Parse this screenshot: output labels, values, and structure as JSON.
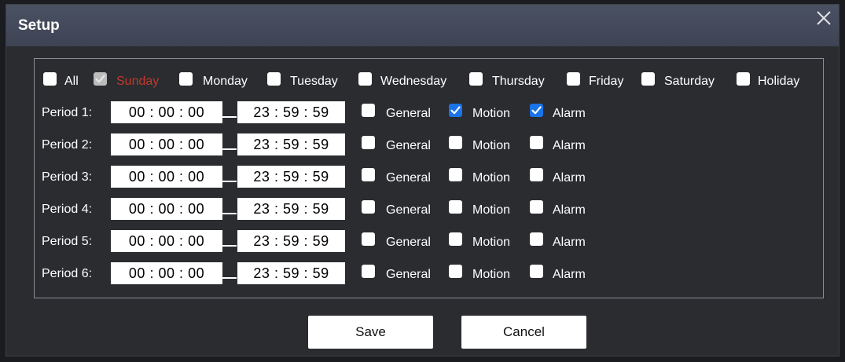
{
  "dialog": {
    "title": "Setup"
  },
  "days": [
    {
      "label": "All",
      "checked": false,
      "disabled": false
    },
    {
      "label": "Sunday",
      "checked": true,
      "disabled": true
    },
    {
      "label": "Monday",
      "checked": false,
      "disabled": false
    },
    {
      "label": "Tuesday",
      "checked": false,
      "disabled": false
    },
    {
      "label": "Wednesday",
      "checked": false,
      "disabled": false
    },
    {
      "label": "Thursday",
      "checked": false,
      "disabled": false
    },
    {
      "label": "Friday",
      "checked": false,
      "disabled": false
    },
    {
      "label": "Saturday",
      "checked": false,
      "disabled": false
    },
    {
      "label": "Holiday",
      "checked": false,
      "disabled": false
    }
  ],
  "periods": [
    {
      "label": "Period 1:",
      "start": [
        "00",
        "00",
        "00"
      ],
      "end": [
        "23",
        "59",
        "59"
      ],
      "general": false,
      "motion": true,
      "alarm": true
    },
    {
      "label": "Period 2:",
      "start": [
        "00",
        "00",
        "00"
      ],
      "end": [
        "23",
        "59",
        "59"
      ],
      "general": false,
      "motion": false,
      "alarm": false
    },
    {
      "label": "Period 3:",
      "start": [
        "00",
        "00",
        "00"
      ],
      "end": [
        "23",
        "59",
        "59"
      ],
      "general": false,
      "motion": false,
      "alarm": false
    },
    {
      "label": "Period 4:",
      "start": [
        "00",
        "00",
        "00"
      ],
      "end": [
        "23",
        "59",
        "59"
      ],
      "general": false,
      "motion": false,
      "alarm": false
    },
    {
      "label": "Period 5:",
      "start": [
        "00",
        "00",
        "00"
      ],
      "end": [
        "23",
        "59",
        "59"
      ],
      "general": false,
      "motion": false,
      "alarm": false
    },
    {
      "label": "Period 6:",
      "start": [
        "00",
        "00",
        "00"
      ],
      "end": [
        "23",
        "59",
        "59"
      ],
      "general": false,
      "motion": false,
      "alarm": false
    }
  ],
  "record_types": {
    "general": "General",
    "motion": "Motion",
    "alarm": "Alarm"
  },
  "time_separator": ":",
  "buttons": {
    "save": "Save",
    "cancel": "Cancel"
  },
  "colors": {
    "titlebar": "#434a5b",
    "background": "#2b2c30",
    "checked": "#1a73e8",
    "disabled_day_text": "#c0392b"
  }
}
